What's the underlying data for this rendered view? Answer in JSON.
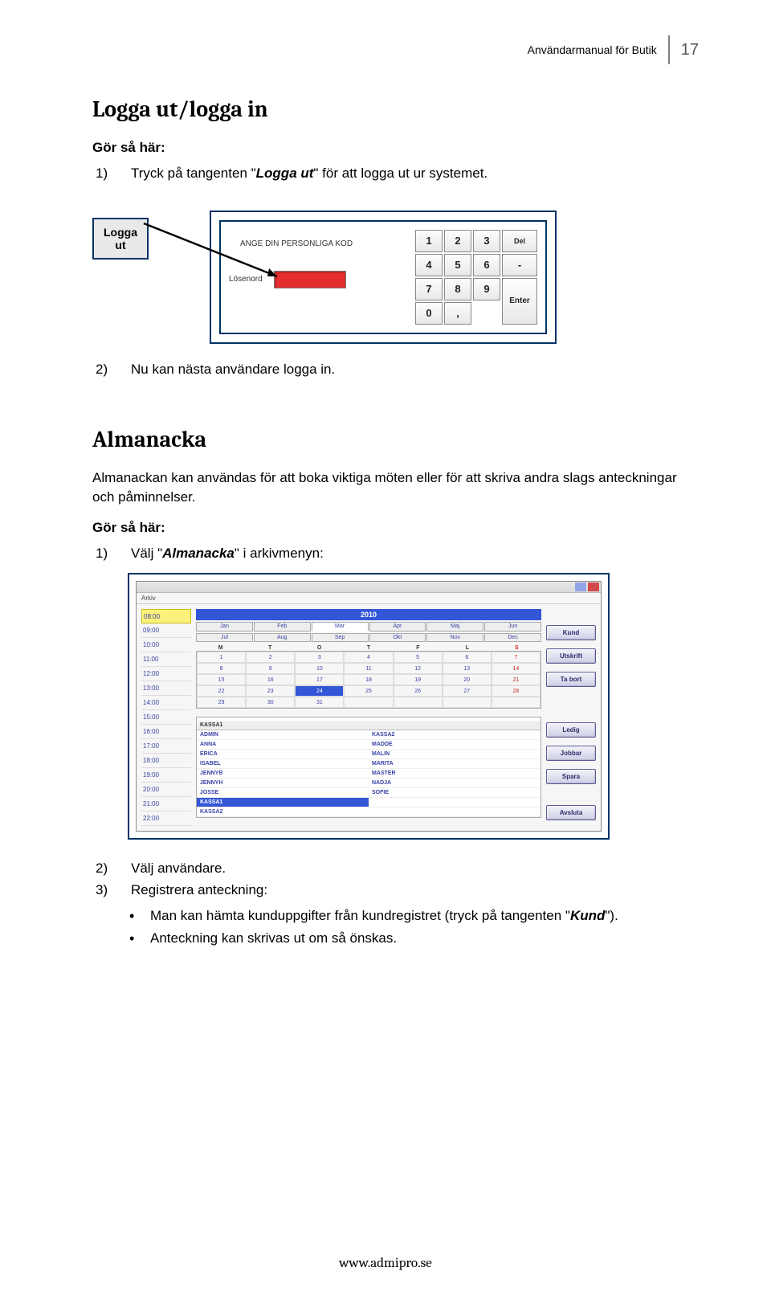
{
  "header": {
    "title": "Användarmanual för Butik",
    "page_number": "17"
  },
  "section1": {
    "heading": "Logga ut/logga in",
    "howto_label": "Gör så här:",
    "step1_pre": "Tryck på tangenten \"",
    "step1_mid": "Logga ut",
    "step1_post": "\" för att logga ut ur systemet.",
    "step2": "Nu kan nästa användare logga in."
  },
  "fig1": {
    "button_line1": "Logga",
    "button_line2": "ut",
    "prompt": "ANGE DIN PERSONLIGA KOD",
    "pw_label": "Lösenord",
    "keys": [
      "1",
      "2",
      "3",
      "Del",
      "4",
      "5",
      "6",
      "-",
      "7",
      "8",
      "9",
      "0",
      ",",
      "Enter"
    ]
  },
  "section2": {
    "heading": "Almanacka",
    "intro": "Almanackan kan användas för att boka viktiga möten eller för att skriva andra slags anteckningar och påminnelser.",
    "howto_label": "Gör så här:",
    "step1_pre": "Välj \"",
    "step1_mid": "Almanacka",
    "step1_post": "\" i arkivmenyn:",
    "step2": "Välj användare.",
    "step3": "Registrera anteckning:",
    "bullet1_pre": "Man kan hämta kunduppgifter från kundregistret (tryck på tangenten \"",
    "bullet1_mid": "Kund",
    "bullet1_post": "\").",
    "bullet2": "Anteckning kan skrivas ut om så önskas."
  },
  "almanacka": {
    "menu": "Arkiv",
    "year": "2010",
    "months_row1": [
      "Jan",
      "Feb",
      "Mar",
      "Apr",
      "Maj",
      "Jun"
    ],
    "months_row2": [
      "Jul",
      "Aug",
      "Sep",
      "Okt",
      "Nov",
      "Dec"
    ],
    "selected_month": "Mar",
    "wdays": [
      "M",
      "T",
      "O",
      "T",
      "F",
      "L",
      "S"
    ],
    "days": [
      "1",
      "2",
      "3",
      "4",
      "5",
      "6",
      "7",
      "8",
      "9",
      "10",
      "11",
      "12",
      "13",
      "14",
      "15",
      "16",
      "17",
      "18",
      "19",
      "20",
      "21",
      "22",
      "23",
      "24",
      "25",
      "26",
      "27",
      "28",
      "29",
      "30",
      "31",
      "",
      "",
      "",
      ""
    ],
    "selected_day": "24",
    "times": [
      "08:00",
      "09:00",
      "10:00",
      "11:00",
      "12:00",
      "13:00",
      "14:00",
      "15:00",
      "16:00",
      "17:00",
      "18:00",
      "19:00",
      "20:00",
      "21:00",
      "22:00"
    ],
    "userbox_header": "KASSA1",
    "users_left": [
      "ADMIN",
      "ANNA",
      "ERICA",
      "ISABEL",
      "JENNYB",
      "JENNYH",
      "JOSSE",
      "KASSA1",
      "KASSA2"
    ],
    "users_right": [
      "KASSA2",
      "MADDE",
      "MALIN",
      "MARITA",
      "MASTER",
      "NADJA",
      "SOFIE",
      "",
      ""
    ],
    "selected_user": "KASSA1",
    "buttons": [
      "Kund",
      "Utskrift",
      "Ta bort",
      "Ledig",
      "Jobbar",
      "Spara",
      "Avsluta"
    ]
  },
  "footer": {
    "link": "www.admipro.se"
  }
}
